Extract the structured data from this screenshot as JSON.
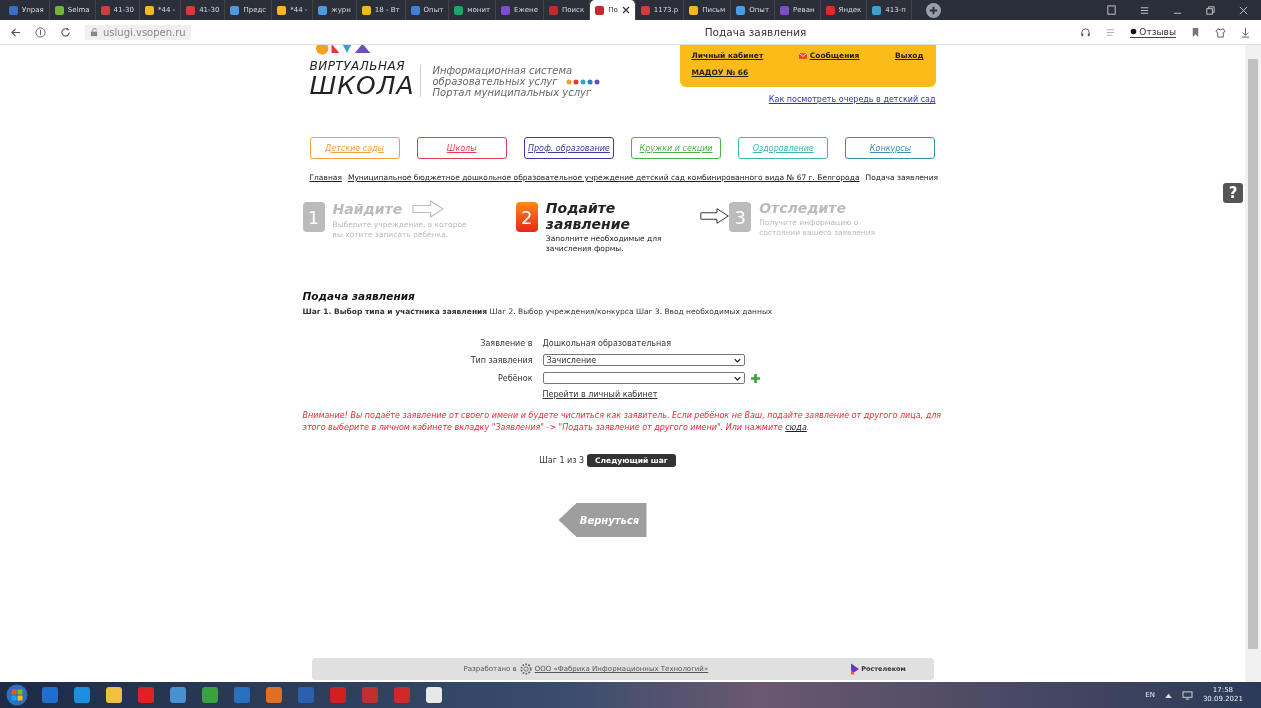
{
  "browser": {
    "tabs": [
      {
        "label": "Упрая",
        "color": "#3b6fc4",
        "selected": false
      },
      {
        "label": "Selma",
        "color": "#6fb43c",
        "selected": false
      },
      {
        "label": "41-30",
        "color": "#d23b3b",
        "selected": false
      },
      {
        "label": "*44 -",
        "color": "#f2b81e",
        "selected": false
      },
      {
        "label": "41-30",
        "color": "#d23b3b",
        "selected": false
      },
      {
        "label": "Предс",
        "color": "#4b9be0",
        "selected": false
      },
      {
        "label": "*44 -",
        "color": "#f2b81e",
        "selected": false
      },
      {
        "label": "журн",
        "color": "#4b9be0",
        "selected": false
      },
      {
        "label": "18 - Вт",
        "color": "#f2b81e",
        "selected": false
      },
      {
        "label": "Опыт",
        "color": "#3f7fe0",
        "selected": false
      },
      {
        "label": "монит",
        "color": "#21a366",
        "selected": false
      },
      {
        "label": "Ежене",
        "color": "#7b4fc9",
        "selected": false
      },
      {
        "label": "Поиск",
        "color": "#c8282d",
        "selected": false
      },
      {
        "label": "По",
        "color": "#c8282d",
        "selected": true
      },
      {
        "label": "1173.р",
        "color": "#d23b3b",
        "selected": false
      },
      {
        "label": "Письм",
        "color": "#f2b81e",
        "selected": false
      },
      {
        "label": "Опыт",
        "color": "#4b9be0",
        "selected": false
      },
      {
        "label": "Реван",
        "color": "#7b4fc9",
        "selected": false
      },
      {
        "label": "Яндек",
        "color": "#e02b2b",
        "selected": false
      },
      {
        "label": "413-п",
        "color": "#3fa0d0",
        "selected": false
      }
    ],
    "address": "uslugi.vsopen.ru",
    "page_title": "Подача заявления",
    "reviews": "Отзывы"
  },
  "header": {
    "logo_line1": "ВИРТУАЛЬНАЯ",
    "logo_line2": "ШКОЛА",
    "tagline": [
      "Информационная система",
      "образовательных услуг",
      "Портал муниципальных услуг"
    ],
    "user_links": [
      "Личный кабинет",
      "Сообщения",
      "Выход"
    ],
    "org": "МАДОУ № 66",
    "queue_link": "Как посмотреть очередь в детский сад"
  },
  "nav": [
    {
      "label": "Детские сады",
      "color": "#f0a040"
    },
    {
      "label": "Школы",
      "color": "#e04050"
    },
    {
      "label": "Проф. образование",
      "color": "#3a3aa0"
    },
    {
      "label": "Кружки и секции",
      "color": "#4cb04c"
    },
    {
      "label": "Оздоровление",
      "color": "#40b8b0"
    },
    {
      "label": "Конкурсы",
      "color": "#3a90a8"
    }
  ],
  "breadcrumb": [
    "Главная",
    "Муниципальное бюджетное дошкольное образовательное учреждение детский сад комбинированного вида № 67 г. Белгорода",
    "Подача заявления"
  ],
  "steps": [
    {
      "number": "1",
      "title": "Найдите",
      "desc": "Выберите учреждение, в которое вы хотите записать ребенка.",
      "selected": false
    },
    {
      "number": "2",
      "title": "Подайте заявление",
      "desc": "Заполните необходимые для зачисления формы.",
      "selected": true
    },
    {
      "number": "3",
      "title": "Отследите",
      "desc": "Получите информацию о состоянии вашего заявления",
      "selected": false
    }
  ],
  "form": {
    "heading": "Подача заявления",
    "progress": "**Шаг 1. Выбор типа и участника заявления** Шаг 2. Выбор учреждения/конкурса Шаг 3. Ввод необходимых данных",
    "rows": [
      {
        "label": "Заявление в",
        "kind": "text",
        "value": "Дошкольная образовательная"
      },
      {
        "label": "Тип заявления",
        "kind": "select",
        "value": "Зачисление"
      },
      {
        "label": "Ребёнок",
        "kind": "select-add",
        "value": ""
      }
    ],
    "cabinet_link": "Перейти в личный кабинет",
    "warning": "Внимание! Вы подаёте заявление от своего имени и будете числиться как заявитель. Если ребёнок не Ваш, подайте заявление от другого лица, для этого выберите в личном кабинете вкладку \"Заявления\" -> \"Подать заявление от другого имени\". Или нажмите",
    "warning_link": "сюда",
    "warning_end": ".",
    "step_counter": "Шаг 1 из 3",
    "next_button": "Следующий шаг",
    "back_button": "Вернуться"
  },
  "help": "?",
  "footer": {
    "developed": "Разработано в",
    "company": "ООО «Фабрика Информационных Технологий»",
    "partner": "Ростелеком"
  },
  "taskbar": {
    "lang": "EN",
    "time": "17:58",
    "date": "30.09.2021"
  }
}
